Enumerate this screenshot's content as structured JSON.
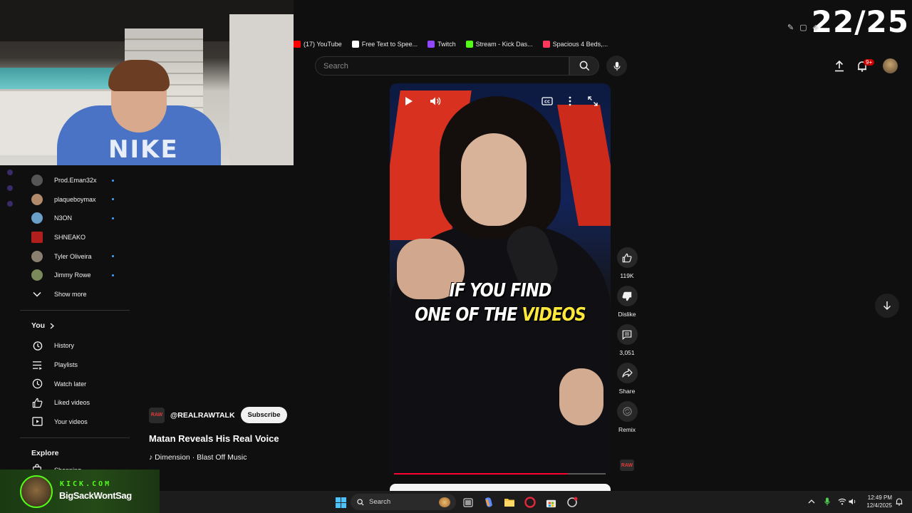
{
  "overlay": {
    "counter": "22/25"
  },
  "bookmarks": [
    {
      "label": "(17) YouTube",
      "color": "#ff0000"
    },
    {
      "label": "Free Text to Spee...",
      "color": "#ffffff"
    },
    {
      "label": "Twitch",
      "color": "#9146ff"
    },
    {
      "label": "Stream - Kick Das...",
      "color": "#53fc18"
    },
    {
      "label": "Spacious 4 Beds,...",
      "color": "#ff385c"
    }
  ],
  "header": {
    "search_placeholder": "Search",
    "notification_badge": "9+"
  },
  "sidebar": {
    "subscriptions": [
      {
        "label": "Prod.Eman32x",
        "color": "#555555"
      },
      {
        "label": "plaqueboymax",
        "color": "#b08a6a"
      },
      {
        "label": "N3ON",
        "color": "#6aa0c8"
      },
      {
        "label": "SHNEAKO",
        "color": "#b01e1e"
      },
      {
        "label": "Tyler Oliveira",
        "color": "#8a8070"
      },
      {
        "label": "Jimmy Rowe",
        "color": "#7a8a5a"
      }
    ],
    "show_more": "Show more",
    "you_heading": "You",
    "you_items": [
      {
        "label": "History",
        "icon": "history-icon"
      },
      {
        "label": "Playlists",
        "icon": "playlists-icon"
      },
      {
        "label": "Watch later",
        "icon": "watch-later-icon"
      },
      {
        "label": "Liked videos",
        "icon": "liked-videos-icon"
      },
      {
        "label": "Your videos",
        "icon": "your-videos-icon"
      }
    ],
    "explore_heading": "Explore",
    "explore_items": [
      {
        "label": "Shopping"
      }
    ]
  },
  "video": {
    "caption_line1": "IF YOU FIND",
    "caption_line2_a": "ONE OF THE ",
    "caption_line2_b": "VIDEOS",
    "progress": 0.82,
    "channel_handle": "@REALRAWTALK",
    "channel_avatar_text": "RAW",
    "subscribe_label": "Subscribe",
    "title": "Matan Reveals His Real Voice",
    "music": "Dimension · Blast Off Music"
  },
  "actions": {
    "likes": "119K",
    "dislike": "Dislike",
    "comments": "3,051",
    "share": "Share",
    "remix": "Remix"
  },
  "kick": {
    "brand": "KICK.COM",
    "name": "BigSackWontSag"
  },
  "taskbar": {
    "search": "Search",
    "time": "12:49 PM",
    "date": "12/4/2025"
  }
}
